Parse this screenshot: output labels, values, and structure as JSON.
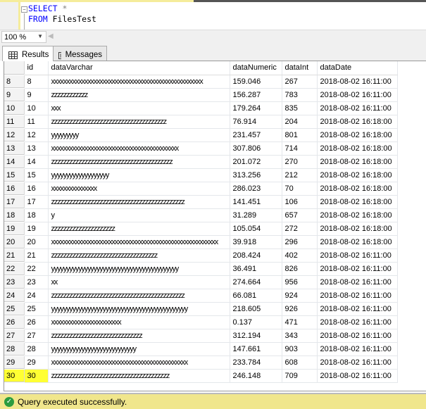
{
  "editor": {
    "line1": {
      "keyword": "SELECT",
      "rest": " *"
    },
    "line2": {
      "keyword": "FROM",
      "rest": " FilesTest"
    }
  },
  "zoom": {
    "value": "100 %"
  },
  "tabs": [
    {
      "label": "Results",
      "icon": "grid-icon",
      "active": true
    },
    {
      "label": "Messages",
      "icon": "messages-icon",
      "active": false
    }
  ],
  "grid": {
    "columns": [
      "",
      "id",
      "dataVarchar",
      "dataNumeric",
      "dataInt",
      "dataDate"
    ],
    "rows": [
      [
        "8",
        "8",
        "xxxxxxxxxxxxxxxxxxxxxxxxxxxxxxxxxxxxxxxxxxxxxxxxxx",
        "159.046",
        "267",
        "2018-08-02 16:11:00"
      ],
      [
        "9",
        "9",
        "zzzzzzzzzzzz",
        "156.287",
        "783",
        "2018-08-02 16:11:00"
      ],
      [
        "10",
        "10",
        "xxx",
        "179.264",
        "835",
        "2018-08-02 16:11:00"
      ],
      [
        "11",
        "11",
        "zzzzzzzzzzzzzzzzzzzzzzzzzzzzzzzzzzzzzz",
        "76.914",
        "204",
        "2018-08-02 16:18:00"
      ],
      [
        "12",
        "12",
        "yyyyyyyyy",
        "231.457",
        "801",
        "2018-08-02 16:18:00"
      ],
      [
        "13",
        "13",
        "xxxxxxxxxxxxxxxxxxxxxxxxxxxxxxxxxxxxxxxxxx",
        "307.806",
        "714",
        "2018-08-02 16:18:00"
      ],
      [
        "14",
        "14",
        "zzzzzzzzzzzzzzzzzzzzzzzzzzzzzzzzzzzzzzzz",
        "201.072",
        "270",
        "2018-08-02 16:18:00"
      ],
      [
        "15",
        "15",
        "yyyyyyyyyyyyyyyyyyy",
        "313.256",
        "212",
        "2018-08-02 16:18:00"
      ],
      [
        "16",
        "16",
        "xxxxxxxxxxxxxxx",
        "286.023",
        "70",
        "2018-08-02 16:18:00"
      ],
      [
        "17",
        "17",
        "zzzzzzzzzzzzzzzzzzzzzzzzzzzzzzzzzzzzzzzzzzzz",
        "141.451",
        "106",
        "2018-08-02 16:18:00"
      ],
      [
        "18",
        "18",
        "y",
        "31.289",
        "657",
        "2018-08-02 16:18:00"
      ],
      [
        "19",
        "19",
        "zzzzzzzzzzzzzzzzzzzzz",
        "105.054",
        "272",
        "2018-08-02 16:18:00"
      ],
      [
        "20",
        "20",
        "xxxxxxxxxxxxxxxxxxxxxxxxxxxxxxxxxxxxxxxxxxxxxxxxxxxxxxx",
        "39.918",
        "296",
        "2018-08-02 16:18:00"
      ],
      [
        "21",
        "21",
        "zzzzzzzzzzzzzzzzzzzzzzzzzzzzzzzzzzz",
        "208.424",
        "402",
        "2018-08-02 16:11:00"
      ],
      [
        "22",
        "22",
        "yyyyyyyyyyyyyyyyyyyyyyyyyyyyyyyyyyyyyyyyyy",
        "36.491",
        "826",
        "2018-08-02 16:11:00"
      ],
      [
        "23",
        "23",
        "xx",
        "274.664",
        "956",
        "2018-08-02 16:11:00"
      ],
      [
        "24",
        "24",
        "zzzzzzzzzzzzzzzzzzzzzzzzzzzzzzzzzzzzzzzzzzzz",
        "66.081",
        "924",
        "2018-08-02 16:11:00"
      ],
      [
        "25",
        "25",
        "yyyyyyyyyyyyyyyyyyyyyyyyyyyyyyyyyyyyyyyyyyyyy",
        "218.605",
        "926",
        "2018-08-02 16:11:00"
      ],
      [
        "26",
        "26",
        "xxxxxxxxxxxxxxxxxxxxxxx",
        "0.137",
        "471",
        "2018-08-02 16:11:00"
      ],
      [
        "27",
        "27",
        "zzzzzzzzzzzzzzzzzzzzzzzzzzzzzz",
        "312.194",
        "343",
        "2018-08-02 16:11:00"
      ],
      [
        "28",
        "28",
        "yyyyyyyyyyyyyyyyyyyyyyyyyyyy",
        "147.661",
        "903",
        "2018-08-02 16:11:00"
      ],
      [
        "29",
        "29",
        "xxxxxxxxxxxxxxxxxxxxxxxxxxxxxxxxxxxxxxxxxxxxx",
        "233.784",
        "608",
        "2018-08-02 16:11:00"
      ],
      [
        "30",
        "30",
        "zzzzzzzzzzzzzzzzzzzzzzzzzzzzzzzzzzzzzzz",
        "246.148",
        "709",
        "2018-08-02 16:11:00"
      ]
    ],
    "highlighted_row": "30",
    "highlight_color": "#ffff33"
  },
  "status": {
    "text": "Query executed successfully.",
    "icon": "check-circle-icon",
    "color": "#f0e68c"
  }
}
